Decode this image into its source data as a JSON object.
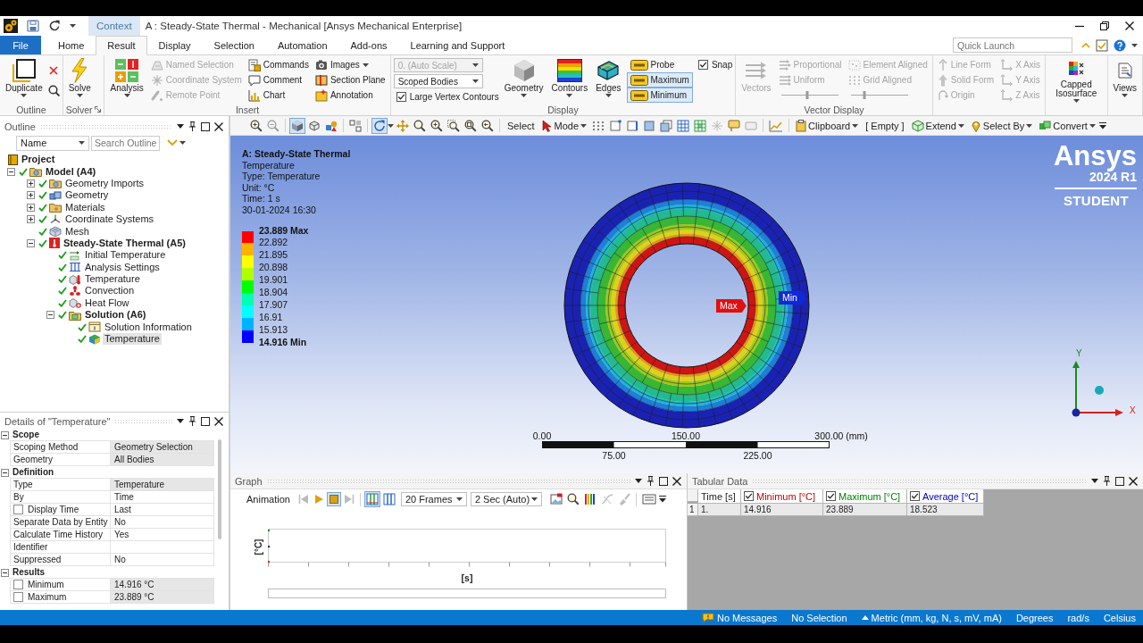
{
  "window": {
    "context_tab": "Context",
    "title": "A : Steady-State Thermal - Mechanical [Ansys Mechanical Enterprise]"
  },
  "ribbon_tabs": [
    {
      "label": "File",
      "kind": "file",
      "selected": false
    },
    {
      "label": "Home",
      "kind": "tab",
      "selected": false
    },
    {
      "label": "Result",
      "kind": "tab",
      "selected": true
    },
    {
      "label": "Display",
      "kind": "tab",
      "selected": false
    },
    {
      "label": "Selection",
      "kind": "tab",
      "selected": false
    },
    {
      "label": "Automation",
      "kind": "tab",
      "selected": false
    },
    {
      "label": "Add-ons",
      "kind": "tab",
      "selected": false
    },
    {
      "label": "Learning and Support",
      "kind": "tab",
      "selected": false
    }
  ],
  "quick_launch": {
    "placeholder": "Quick Launch"
  },
  "ribbon_groups": [
    {
      "label": "Outline",
      "columns": [
        [
          {
            "kind": "large",
            "label": "Duplicate",
            "menu": true,
            "disabled": false
          }
        ],
        [
          {
            "kind": "tool",
            "disabled": false
          },
          {
            "kind": "tool",
            "disabled": false
          }
        ]
      ]
    },
    {
      "label": "Solver",
      "launcher": true,
      "columns": [
        [
          {
            "kind": "large",
            "label": "Solve",
            "menu": true,
            "disabled": false
          }
        ]
      ]
    },
    {
      "label": "Insert",
      "columns": [
        [
          {
            "kind": "large",
            "label": "Analysis",
            "menu": true,
            "disabled": false
          }
        ],
        [
          {
            "kind": "small",
            "label": "Named Selection",
            "disabled": true
          },
          {
            "kind": "small",
            "label": "Coordinate System",
            "disabled": true
          },
          {
            "kind": "small",
            "label": "Remote Point",
            "disabled": true
          }
        ],
        [
          {
            "kind": "small",
            "label": "Commands",
            "disabled": false
          },
          {
            "kind": "small",
            "label": "Comment",
            "disabled": false
          },
          {
            "kind": "small",
            "label": "Chart",
            "disabled": false
          }
        ],
        [
          {
            "kind": "small",
            "label": "Images",
            "menu": true,
            "disabled": false
          },
          {
            "kind": "small",
            "label": "Section Plane",
            "disabled": false
          },
          {
            "kind": "small",
            "label": "Annotation",
            "disabled": false
          }
        ]
      ]
    },
    {
      "label": "Display",
      "columns": [
        [
          {
            "kind": "select",
            "label": "0. (Auto Scale)",
            "disabled": true
          },
          {
            "kind": "select",
            "label": "Scoped Bodies",
            "disabled": false
          },
          {
            "kind": "check",
            "label": "Large Vertex Contours",
            "checked": true,
            "disabled": false
          }
        ],
        [
          {
            "kind": "large",
            "label": "Geometry",
            "menu": true,
            "disabled": false
          }
        ],
        [
          {
            "kind": "large",
            "label": "Contours",
            "menu": true,
            "disabled": false
          }
        ],
        [
          {
            "kind": "large",
            "label": "Edges",
            "menu": true,
            "disabled": false
          }
        ],
        [
          {
            "kind": "toggle",
            "label": "Probe",
            "selected": false,
            "disabled": false
          },
          {
            "kind": "toggle",
            "label": "Maximum",
            "selected": true,
            "disabled": false
          },
          {
            "kind": "toggle",
            "label": "Minimum",
            "selected": true,
            "disabled": false
          }
        ],
        [
          {
            "kind": "check",
            "label": "Snap",
            "checked": true,
            "disabled": false
          }
        ]
      ]
    },
    {
      "label": "Vector Display",
      "columns": [
        [
          {
            "kind": "large",
            "label": "Vectors",
            "disabled": true
          }
        ],
        [
          {
            "kind": "small",
            "label": "Proportional",
            "disabled": true
          },
          {
            "kind": "small",
            "label": "Uniform",
            "disabled": true
          },
          {
            "kind": "slider",
            "level": 0.46,
            "disabled": true
          }
        ],
        [
          {
            "kind": "small",
            "label": "Element Aligned",
            "disabled": true
          },
          {
            "kind": "small",
            "label": "Grid Aligned",
            "disabled": true
          },
          {
            "kind": "slider",
            "level": 0.24,
            "disabled": true
          }
        ]
      ]
    },
    {
      "columns": [
        [
          {
            "kind": "small",
            "label": "Line Form",
            "disabled": true
          },
          {
            "kind": "small",
            "label": "Solid Form",
            "disabled": true
          },
          {
            "kind": "small",
            "label": "Origin",
            "disabled": true
          }
        ],
        [
          {
            "kind": "small",
            "label": "X Axis",
            "disabled": true
          },
          {
            "kind": "small",
            "label": "Y Axis",
            "disabled": true
          },
          {
            "kind": "small",
            "label": "Z Axis",
            "disabled": true
          }
        ]
      ]
    },
    {
      "columns": [
        [
          {
            "kind": "large",
            "label": "Capped Isosurface",
            "menu": true,
            "disabled": false
          }
        ]
      ]
    },
    {
      "columns": [
        [
          {
            "kind": "large",
            "label": "Views",
            "menu": true,
            "disabled": false
          }
        ]
      ]
    }
  ],
  "graphics_toolbar": [
    {
      "kind": "tool",
      "selected": false
    },
    {
      "kind": "tool",
      "selected": false
    },
    {
      "kind": "tool",
      "selected": true
    },
    {
      "kind": "tool",
      "selected": false
    },
    {
      "kind": "tool",
      "selected": false
    },
    {
      "kind": "tool",
      "selected": false
    },
    {
      "kind": "tool",
      "selected": true,
      "menu": true
    },
    {
      "kind": "tool",
      "selected": false
    },
    {
      "kind": "tool",
      "selected": false
    },
    {
      "kind": "tool",
      "selected": false
    },
    {
      "kind": "tool",
      "selected": false
    },
    {
      "kind": "tool",
      "selected": false
    },
    {
      "kind": "tool",
      "selected": false
    },
    {
      "kind": "label",
      "label": "Select"
    },
    {
      "kind": "menu",
      "label": "Mode"
    },
    {
      "kind": "tool",
      "selected": false
    },
    {
      "kind": "tool",
      "selected": false
    },
    {
      "kind": "tool",
      "selected": false
    },
    {
      "kind": "tool",
      "selected": false
    },
    {
      "kind": "tool",
      "selected": false
    },
    {
      "kind": "tool",
      "selected": false
    },
    {
      "kind": "tool",
      "selected": false
    },
    {
      "kind": "tool",
      "selected": false
    },
    {
      "kind": "tool",
      "selected": false
    },
    {
      "kind": "tool",
      "selected": false
    },
    {
      "kind": "tool",
      "selected": false
    },
    {
      "kind": "menu",
      "label": "Clipboard"
    },
    {
      "kind": "text",
      "label": "[ Empty ]"
    },
    {
      "kind": "menu",
      "label": "Extend"
    },
    {
      "kind": "menu",
      "label": "Select By"
    },
    {
      "kind": "menu",
      "label": "Convert"
    }
  ],
  "outline": {
    "title": "Outline",
    "filter": "Name",
    "search": {
      "placeholder": "Search Outline"
    },
    "tree": [
      {
        "label": "Project",
        "kind": "project",
        "selected": false,
        "children": [
          {
            "label": "Model (A4)",
            "kind": "model",
            "solved": true,
            "expanded": true,
            "selected": false,
            "children": [
              {
                "label": "Geometry Imports",
                "kind": "imports",
                "solved": true,
                "expanded": false,
                "selected": false
              },
              {
                "label": "Geometry",
                "kind": "geometry",
                "solved": true,
                "expanded": false,
                "selected": false
              },
              {
                "label": "Materials",
                "kind": "materials",
                "solved": true,
                "expanded": false,
                "selected": false
              },
              {
                "label": "Coordinate Systems",
                "kind": "coordinates",
                "solved": true,
                "expanded": false,
                "selected": false
              },
              {
                "label": "Mesh",
                "kind": "mesh",
                "solved": true,
                "selected": false
              },
              {
                "label": "Steady-State Thermal (A5)",
                "kind": "analysis",
                "solved": true,
                "expanded": true,
                "selected": false,
                "children": [
                  {
                    "label": "Initial Temperature",
                    "kind": "initial",
                    "solved": true,
                    "selected": false
                  },
                  {
                    "label": "Analysis Settings",
                    "kind": "settings",
                    "solved": true,
                    "selected": false
                  },
                  {
                    "label": "Temperature",
                    "kind": "temperature",
                    "solved": true,
                    "selected": false
                  },
                  {
                    "label": "Convection",
                    "kind": "convection",
                    "solved": true,
                    "selected": false
                  },
                  {
                    "label": "Heat Flow",
                    "kind": "heatflow",
                    "solved": true,
                    "selected": false
                  },
                  {
                    "label": "Solution (A6)",
                    "kind": "solution",
                    "solved": true,
                    "expanded": true,
                    "selected": false,
                    "children": [
                      {
                        "label": "Solution Information",
                        "kind": "information",
                        "solved": true,
                        "selected": false
                      },
                      {
                        "label": "Temperature",
                        "kind": "result",
                        "solved": true,
                        "selected": true
                      }
                    ]
                  }
                ]
              }
            ]
          }
        ]
      }
    ]
  },
  "details": {
    "title": "Details of \"Temperature\"",
    "sections": [
      {
        "title": "Scope",
        "expanded": true,
        "rows": [
          {
            "label": "Scoping Method",
            "value": "Geometry Selection",
            "kind": "plain",
            "shaded": true
          },
          {
            "label": "Geometry",
            "value": "All Bodies",
            "kind": "plain",
            "shaded": true
          }
        ]
      },
      {
        "title": "Definition",
        "expanded": true,
        "rows": [
          {
            "label": "Type",
            "value": "Temperature",
            "kind": "plain",
            "shaded": true
          },
          {
            "label": "By",
            "value": "Time",
            "kind": "plain",
            "shaded": false
          },
          {
            "label": "Display Time",
            "value": "Last",
            "kind": "check",
            "checked": false,
            "shaded": false
          },
          {
            "label": "Separate Data by Entity",
            "value": "No",
            "kind": "plain",
            "shaded": false
          },
          {
            "label": "Calculate Time History",
            "value": "Yes",
            "kind": "plain",
            "shaded": false
          },
          {
            "label": "Identifier",
            "kind": "plain",
            "shaded": false
          },
          {
            "label": "Suppressed",
            "value": "No",
            "kind": "plain",
            "shaded": false
          }
        ]
      },
      {
        "title": "Results",
        "expanded": true,
        "rows": [
          {
            "label": "Minimum",
            "value": "14.916 °C",
            "kind": "check",
            "checked": false,
            "shaded": true
          },
          {
            "label": "Maximum",
            "value": "23.889 °C",
            "kind": "check",
            "checked": false,
            "shaded": true
          }
        ]
      }
    ]
  },
  "viewport": {
    "title_lines": [
      {
        "text": "A: Steady-State Thermal",
        "kind": "heading"
      },
      {
        "text": "Temperature",
        "kind": "line"
      },
      {
        "text": "Type: Temperature",
        "kind": "line"
      },
      {
        "text": "Unit: °C",
        "kind": "line"
      },
      {
        "text": "Time: 1 s",
        "kind": "line"
      },
      {
        "text": "30-01-2024 16:30",
        "kind": "line"
      }
    ],
    "legend": {
      "labels": [
        {
          "text": "23.889 Max",
          "kind": "extreme"
        },
        {
          "text": "22.892",
          "kind": "level"
        },
        {
          "text": "21.895",
          "kind": "level"
        },
        {
          "text": "20.898",
          "kind": "level"
        },
        {
          "text": "19.901",
          "kind": "level"
        },
        {
          "text": "18.904",
          "kind": "level"
        },
        {
          "text": "17.907",
          "kind": "level"
        },
        {
          "text": "16.91",
          "kind": "level"
        },
        {
          "text": "15.913",
          "kind": "level"
        },
        {
          "text": "14.916 Min",
          "kind": "extreme"
        }
      ],
      "bands": [
        {
          "color": "#ff0000"
        },
        {
          "color": "#ffb200"
        },
        {
          "color": "#ffff00"
        },
        {
          "color": "#b2ff00"
        },
        {
          "color": "#00ff00"
        },
        {
          "color": "#00ffb2"
        },
        {
          "color": "#00ffff"
        },
        {
          "color": "#00b2ff"
        },
        {
          "color": "#0000ff"
        }
      ]
    },
    "probes": [
      {
        "label": "Max",
        "kind": "max"
      },
      {
        "label": "Min",
        "kind": "min"
      }
    ],
    "logo": {
      "brand": "Ansys",
      "release": "2024 R1",
      "edition": "STUDENT"
    },
    "scale_bar": {
      "top_labels": [
        "0.00",
        "150.00",
        "300.00 (mm)"
      ],
      "bottom_labels": [
        "75.00",
        "225.00"
      ]
    },
    "triad": {
      "labels": [
        "Y",
        "X"
      ]
    }
  },
  "graph": {
    "title": "Graph",
    "toolbar": {
      "label": "Animation",
      "controls": [
        {
          "selected": false
        },
        {
          "selected": false
        },
        {
          "selected": true
        },
        {
          "selected": false
        }
      ],
      "modes": [
        {
          "selected": true
        },
        {
          "selected": false
        }
      ],
      "frames": "20 Frames",
      "duration": "2 Sec (Auto)"
    },
    "ylabel": "[°C]",
    "xlabel": "[s]"
  },
  "tabular": {
    "title": "Tabular Data",
    "columns": [
      {
        "label": "Time [s]",
        "kind": "plain"
      },
      {
        "label": "Minimum [°C]",
        "kind": "check",
        "checked": true,
        "color": "#c00000"
      },
      {
        "label": "Maximum [°C]",
        "kind": "check",
        "checked": true,
        "color": "#008000"
      },
      {
        "label": "Average [°C]",
        "kind": "check",
        "checked": true,
        "color": "#0000c0"
      }
    ],
    "rows": [
      {
        "index": "1",
        "cells": [
          "1.",
          "14.916",
          "23.889",
          "18.523"
        ]
      }
    ]
  },
  "status_bar": [
    {
      "text": "No Messages",
      "kind": "messages"
    },
    {
      "text": "No Selection",
      "kind": "text"
    },
    {
      "text": "Metric (mm, kg, N, s, mV, mA)",
      "kind": "menu"
    },
    {
      "text": "Degrees",
      "kind": "text"
    },
    {
      "text": "rad/s",
      "kind": "text"
    },
    {
      "text": "Celsius",
      "kind": "text"
    }
  ]
}
